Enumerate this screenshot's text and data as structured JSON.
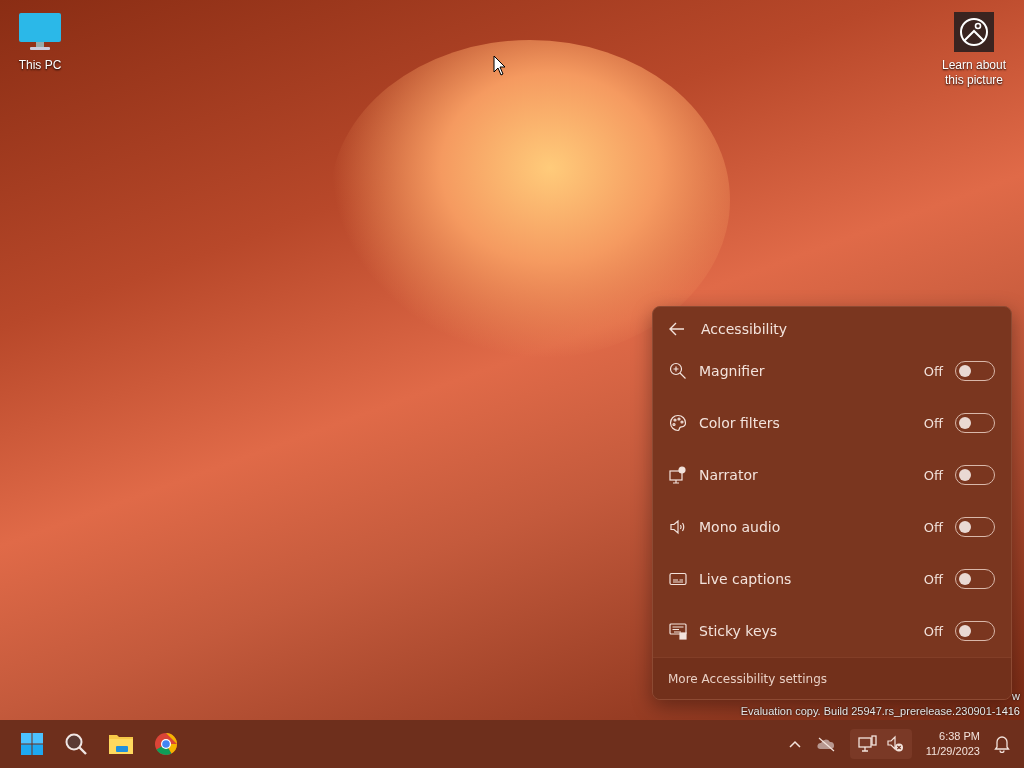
{
  "desktop": {
    "icons": [
      {
        "kind": "computer",
        "label": "This PC"
      },
      {
        "kind": "picture",
        "label": "Learn about this picture"
      }
    ],
    "watermark": [
      "w",
      "Evaluation copy. Build 25947.rs_prerelease.230901-1416"
    ]
  },
  "flyout": {
    "title": "Accessibility",
    "items": [
      {
        "kind": "magnifier",
        "name": "Magnifier",
        "state_text": "Off",
        "on": false
      },
      {
        "kind": "palette",
        "name": "Color filters",
        "state_text": "Off",
        "on": false
      },
      {
        "kind": "narrator",
        "name": "Narrator",
        "state_text": "Off",
        "on": false
      },
      {
        "kind": "speaker",
        "name": "Mono audio",
        "state_text": "Off",
        "on": false
      },
      {
        "kind": "captions",
        "name": "Live captions",
        "state_text": "Off",
        "on": false
      },
      {
        "kind": "keyboard",
        "name": "Sticky keys",
        "state_text": "Off",
        "on": false
      }
    ],
    "footer_link": "More Accessibility settings"
  },
  "taskbar": {
    "time": "6:38 PM",
    "date": "11/29/2023"
  }
}
